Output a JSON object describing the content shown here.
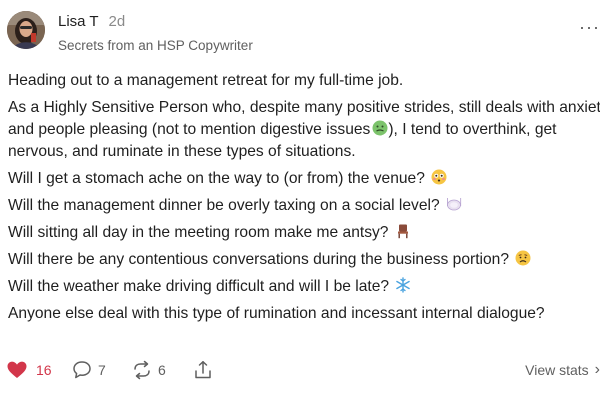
{
  "author": {
    "name": "Lisa T",
    "time": "2d",
    "publication": "Secrets from an HSP Copywriter",
    "avatar_icon": "profile-photo"
  },
  "menu": {
    "more_label": "···"
  },
  "post": {
    "paragraphs": [
      {
        "text": "Heading out to a management retreat for my full-time job.",
        "emoji": null
      },
      {
        "lines": [
          "As a Highly Sensitive Person who, despite many positive strides, still deals with anxiety",
          "and people pleasing (not to mention digestive issues",
          "), I tend to overthink, get",
          "nervous, and ruminate in these types of situations."
        ],
        "emoji": "nauseated-face"
      },
      {
        "text": "Will I get a stomach ache on the way to (or from) the venue?",
        "emoji": "flushed-face"
      },
      {
        "text": "Will the management dinner be overly taxing on a social level?",
        "emoji": "plate-icon"
      },
      {
        "text": "Will sitting all day in the meeting room make me antsy?",
        "emoji": "chair-icon"
      },
      {
        "text": "Will there be any contentious conversations during the business portion?",
        "emoji": "worried-face"
      },
      {
        "text": "Will the weather make driving difficult and will I be late?",
        "emoji": "snowflake-icon"
      },
      {
        "text": "Anyone else deal with this type of rumination and incessant internal dialogue?",
        "emoji": null
      }
    ]
  },
  "actions": {
    "likes": "16",
    "comments": "7",
    "restacks": "6",
    "view_stats": "View stats",
    "view_stats_chevron": "›"
  },
  "colors": {
    "like_red": "#d2364a",
    "text": "#1f1f1f",
    "muted": "#5f5f5f"
  }
}
